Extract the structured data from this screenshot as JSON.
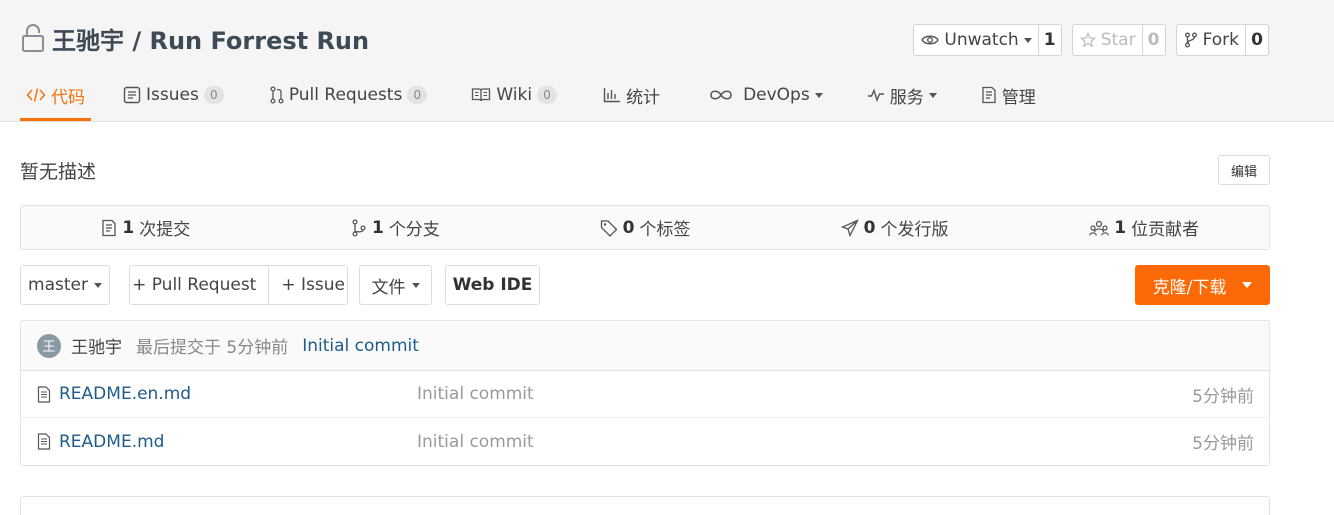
{
  "repo": {
    "title": "王驰宇 / Run Forrest Run"
  },
  "actions": {
    "watch": {
      "label": "Unwatch",
      "count": "1"
    },
    "star": {
      "label": "Star",
      "count": "0"
    },
    "fork": {
      "label": "Fork",
      "count": "0"
    }
  },
  "tabs": [
    {
      "label": "代码",
      "icon": "code-icon",
      "active": true
    },
    {
      "label": "Issues",
      "badge": "0",
      "icon": "issues-icon"
    },
    {
      "label": "Pull Requests",
      "badge": "0",
      "icon": "pull-request-icon"
    },
    {
      "label": "Wiki",
      "badge": "0",
      "icon": "book-icon"
    },
    {
      "label": "统计",
      "icon": "bar-chart-icon"
    },
    {
      "label": "DevOps",
      "icon": "infinity-icon",
      "dropdown": true
    },
    {
      "label": "服务",
      "icon": "pulse-icon",
      "dropdown": true
    },
    {
      "label": "管理",
      "icon": "settings-doc-icon"
    }
  ],
  "description": {
    "text": "暂无描述",
    "edit_label": "编辑"
  },
  "stats": [
    {
      "count": "1",
      "label": "次提交",
      "icon": "commit-doc-icon"
    },
    {
      "count": "1",
      "label": "个分支",
      "icon": "branch-icon"
    },
    {
      "count": "0",
      "label": "个标签",
      "icon": "tag-icon"
    },
    {
      "count": "0",
      "label": "个发行版",
      "icon": "send-icon"
    },
    {
      "count": "1",
      "label": "位贡献者",
      "icon": "contributors-icon"
    }
  ],
  "toolbar": {
    "branch": "master",
    "pull_request": "+ Pull Request",
    "issue": "+ Issue",
    "files": "文件",
    "web_ide": "Web IDE",
    "clone": "克隆/下载"
  },
  "last_commit": {
    "avatar_letter": "王",
    "author": "王驰宇",
    "time": "最后提交于 5分钟前",
    "message": "Initial commit"
  },
  "files": [
    {
      "name": "README.en.md",
      "message": "Initial commit",
      "time": "5分钟前"
    },
    {
      "name": "README.md",
      "message": "Initial commit",
      "time": "5分钟前"
    }
  ],
  "colors": {
    "accent": "#f5730a",
    "clone_button": "#fc6a08",
    "link": "#1d5b8a"
  }
}
